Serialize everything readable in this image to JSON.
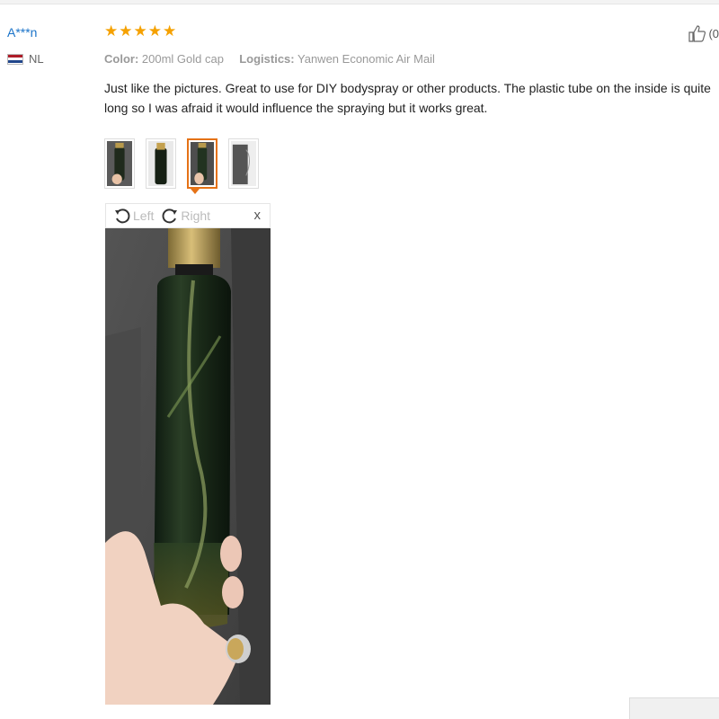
{
  "reviewer": {
    "name": "A***n",
    "country_code": "NL",
    "flag_colors": [
      "#ae1c28",
      "#ffffff",
      "#21468b"
    ]
  },
  "review": {
    "rating": 5,
    "stars": [
      "★",
      "★",
      "★",
      "★",
      "★"
    ],
    "color_label": "Color:",
    "color_value": "200ml Gold cap",
    "logistics_label": "Logistics:",
    "logistics_value": "Yanwen Economic Air Mail",
    "text": "Just like the pictures. Great to use for DIY bodyspray or other products. The plastic tube on the inside is quite long so I was afraid it would influence the spraying but it works great.",
    "helpful_count": "(0"
  },
  "viewer": {
    "rotate_left_label": "Left",
    "rotate_right_label": "Right",
    "close_label": "x",
    "selected_thumb_index": 2
  },
  "thumbnails": [
    {
      "name": "photo-1",
      "selected": false
    },
    {
      "name": "photo-2",
      "selected": false
    },
    {
      "name": "photo-3",
      "selected": true
    },
    {
      "name": "photo-4",
      "selected": false
    }
  ],
  "colors": {
    "accent": "#e57216",
    "star": "#f5a100",
    "link": "#1a73c9",
    "muted": "#999999"
  },
  "icons": [
    "thumbs-up-icon",
    "rotate-left-icon",
    "rotate-right-icon",
    "close-icon",
    "star-icon",
    "flag-icon"
  ]
}
